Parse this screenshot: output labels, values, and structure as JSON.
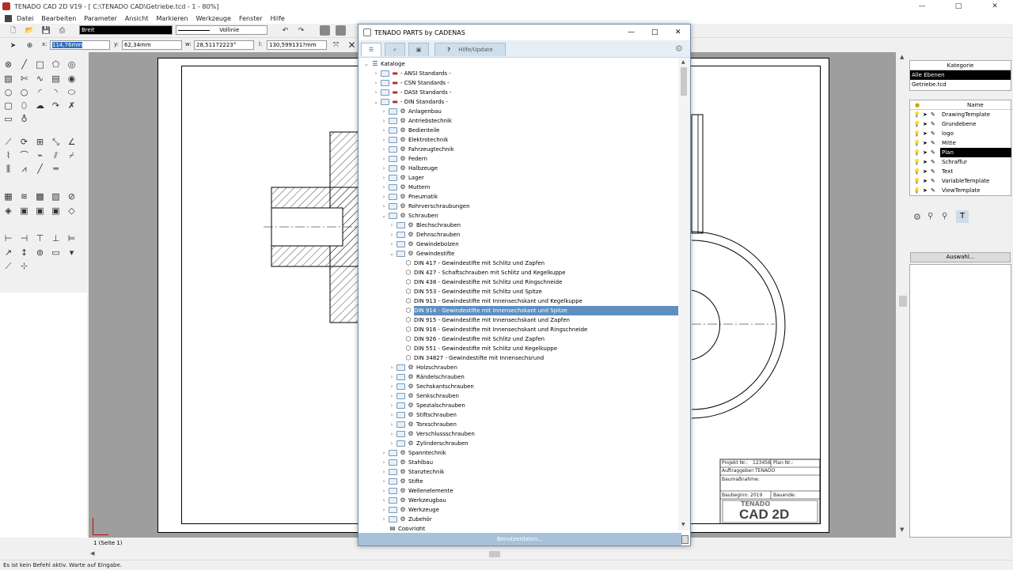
{
  "window": {
    "title": "TENADO CAD 2D V19 - [ C:\\TENADO CAD\\Getriebe.tcd - 1 - 80%]",
    "minimize": "—",
    "maximize": "□",
    "close": "✕"
  },
  "menu": [
    "Datei",
    "Bearbeiten",
    "Parameter",
    "Ansicht",
    "Markieren",
    "Werkzeuge",
    "Fenster",
    "Hilfe"
  ],
  "toolbar": {
    "color_value": "Breit",
    "line_value": "Vollinie"
  },
  "coords": {
    "x_label": "x:",
    "x_value": "114,76mm",
    "y_label": "y:",
    "y_value": "62,34mm",
    "w_label": "w:",
    "w_value": "28,51172223°",
    "l_label": "l:",
    "l_value": "130,599131?mm"
  },
  "dialog": {
    "title": "TENADO PARTS by CADENAS",
    "tab_help": "Hilfe/Update",
    "footer_button": "Benutzerdaten...",
    "tree": [
      {
        "label": "Kataloge",
        "level": 0,
        "arrow": "v",
        "icon": "db"
      },
      {
        "label": "- ANSI Standards -",
        "level": 1,
        "arrow": ">",
        "icon": "flag"
      },
      {
        "label": "- CSN Standards -",
        "level": 1,
        "arrow": ">",
        "icon": "flag"
      },
      {
        "label": "- DASt Standards -",
        "level": 1,
        "arrow": ">",
        "icon": "flag"
      },
      {
        "label": "- DIN Standards -",
        "level": 1,
        "arrow": "v",
        "icon": "flag"
      },
      {
        "label": "Anlagenbau",
        "level": 2,
        "arrow": ">",
        "icon": "part"
      },
      {
        "label": "Antriebstechnik",
        "level": 2,
        "arrow": ">",
        "icon": "part"
      },
      {
        "label": "Bedienteile",
        "level": 2,
        "arrow": ">",
        "icon": "part"
      },
      {
        "label": "Elektrotechnik",
        "level": 2,
        "arrow": ">",
        "icon": "part"
      },
      {
        "label": "Fahrzeugtechnik",
        "level": 2,
        "arrow": ">",
        "icon": "part"
      },
      {
        "label": "Federn",
        "level": 2,
        "arrow": ">",
        "icon": "part"
      },
      {
        "label": "Halbzeuge",
        "level": 2,
        "arrow": ">",
        "icon": "part"
      },
      {
        "label": "Lager",
        "level": 2,
        "arrow": ">",
        "icon": "part"
      },
      {
        "label": "Muttern",
        "level": 2,
        "arrow": ">",
        "icon": "part"
      },
      {
        "label": "Pneumatik",
        "level": 2,
        "arrow": ">",
        "icon": "part"
      },
      {
        "label": "Rohrverschraubungen",
        "level": 2,
        "arrow": ">",
        "icon": "part"
      },
      {
        "label": "Schrauben",
        "level": 2,
        "arrow": "v",
        "icon": "part"
      },
      {
        "label": "Blechschrauben",
        "level": 3,
        "arrow": ">",
        "icon": "part"
      },
      {
        "label": "Dehnschrauben",
        "level": 3,
        "arrow": ">",
        "icon": "part"
      },
      {
        "label": "Gewindebolzen",
        "level": 3,
        "arrow": ">",
        "icon": "part"
      },
      {
        "label": "Gewindestifte",
        "level": 3,
        "arrow": "v",
        "icon": "part"
      },
      {
        "label": "DIN 417 - Gewindestifte mit Schlitz und Zapfen",
        "level": 4,
        "arrow": "",
        "icon": "cube"
      },
      {
        "label": "DIN 427 - Schaftschrauben mit Schlitz und Kegelkuppe",
        "level": 4,
        "arrow": "",
        "icon": "cube"
      },
      {
        "label": "DIN 438 - Gewindestifte mit Schlitz und Ringschneide",
        "level": 4,
        "arrow": "",
        "icon": "cube"
      },
      {
        "label": "DIN 553 - Gewindestifte mit Schlitz und Spitze",
        "level": 4,
        "arrow": "",
        "icon": "cube"
      },
      {
        "label": "DIN 913 - Gewindestifte mit Innensechskant und Kegelkuppe",
        "level": 4,
        "arrow": "",
        "icon": "cube"
      },
      {
        "label": "DIN 914 - Gewindestifte mit Innensechskant und Spitze",
        "level": 4,
        "arrow": "",
        "icon": "cube",
        "selected": true
      },
      {
        "label": "DIN 915 - Gewindestifte mit Innensechskant und Zapfen",
        "level": 4,
        "arrow": "",
        "icon": "cube"
      },
      {
        "label": "DIN 916 - Gewindestifte mit Innensechskant und Ringschneide",
        "level": 4,
        "arrow": "",
        "icon": "cube"
      },
      {
        "label": "DIN 926 - Gewindestifte mit Schlitz und Zapfen",
        "level": 4,
        "arrow": "",
        "icon": "cube"
      },
      {
        "label": "DIN 551 - Gewindestifte mit Schlitz und Kegelkuppe",
        "level": 4,
        "arrow": "",
        "icon": "cube"
      },
      {
        "label": "DIN 34827 - Gewindestifte mit Innensechsrund",
        "level": 4,
        "arrow": "",
        "icon": "cube"
      },
      {
        "label": "Holzschrauben",
        "level": 3,
        "arrow": ">",
        "icon": "part"
      },
      {
        "label": "Rändelschrauben",
        "level": 3,
        "arrow": ">",
        "icon": "part"
      },
      {
        "label": "Sechskantschrauben",
        "level": 3,
        "arrow": ">",
        "icon": "part"
      },
      {
        "label": "Senkschrauben",
        "level": 3,
        "arrow": ">",
        "icon": "part"
      },
      {
        "label": "Spezialschrauben",
        "level": 3,
        "arrow": ">",
        "icon": "part"
      },
      {
        "label": "Stiftschrauben",
        "level": 3,
        "arrow": ">",
        "icon": "part"
      },
      {
        "label": "Torxschrauben",
        "level": 3,
        "arrow": ">",
        "icon": "part"
      },
      {
        "label": "Verschlussschrauben",
        "level": 3,
        "arrow": ">",
        "icon": "part"
      },
      {
        "label": "Zylinderschrauben",
        "level": 3,
        "arrow": ">",
        "icon": "part"
      },
      {
        "label": "Spanntechnik",
        "level": 2,
        "arrow": ">",
        "icon": "part"
      },
      {
        "label": "Stahlbau",
        "level": 2,
        "arrow": ">",
        "icon": "part"
      },
      {
        "label": "Stanztechnik",
        "level": 2,
        "arrow": ">",
        "icon": "part"
      },
      {
        "label": "Stifte",
        "level": 2,
        "arrow": ">",
        "icon": "part"
      },
      {
        "label": "Wellenelemente",
        "level": 2,
        "arrow": ">",
        "icon": "part"
      },
      {
        "label": "Werkzeugbau",
        "level": 2,
        "arrow": ">",
        "icon": "part"
      },
      {
        "label": "Werkzeuge",
        "level": 2,
        "arrow": ">",
        "icon": "part"
      },
      {
        "label": "Zubehör",
        "level": 2,
        "arrow": ">",
        "icon": "part"
      },
      {
        "label": "Copyright",
        "level": 2,
        "arrow": "",
        "icon": "doc"
      }
    ]
  },
  "titleblock": {
    "projekt_label": "Projekt Nr.:",
    "projekt_value": "123456",
    "plan_label": "Plan Nr.:",
    "auftrag_label": "Auftraggeber:",
    "auftrag_value": "TENADO",
    "baumassnahme_label": "Baumaßnahme:",
    "baubeginn_label": "Baubeginn:",
    "baubeginn_value": "2019",
    "bauende_label": "Bauende:",
    "logo_top": "TENADO",
    "logo_main": "CAD 2D"
  },
  "right": {
    "kategorie_header": "Kategorie",
    "kategorien": [
      "Alle Ebenen",
      "Getriebe.tcd"
    ],
    "name_header": "Name",
    "layers": [
      "DrawingTemplate",
      "Grundebene",
      "logo",
      "Mitte",
      "Plan",
      "Schraffur",
      "Text",
      "VariableTemplate",
      "ViewTemplate"
    ],
    "selected_layer": "Plan",
    "auswahl_button": "Auswahl..."
  },
  "bottom": {
    "page_tab": "1 (Seite 1)"
  },
  "status": "Es ist kein Befehl aktiv. Warte auf Eingabe.",
  "colors": {
    "selection": "#5e8fbf",
    "category_selected": "#000000",
    "dialog_border": "#6e8ca8"
  }
}
